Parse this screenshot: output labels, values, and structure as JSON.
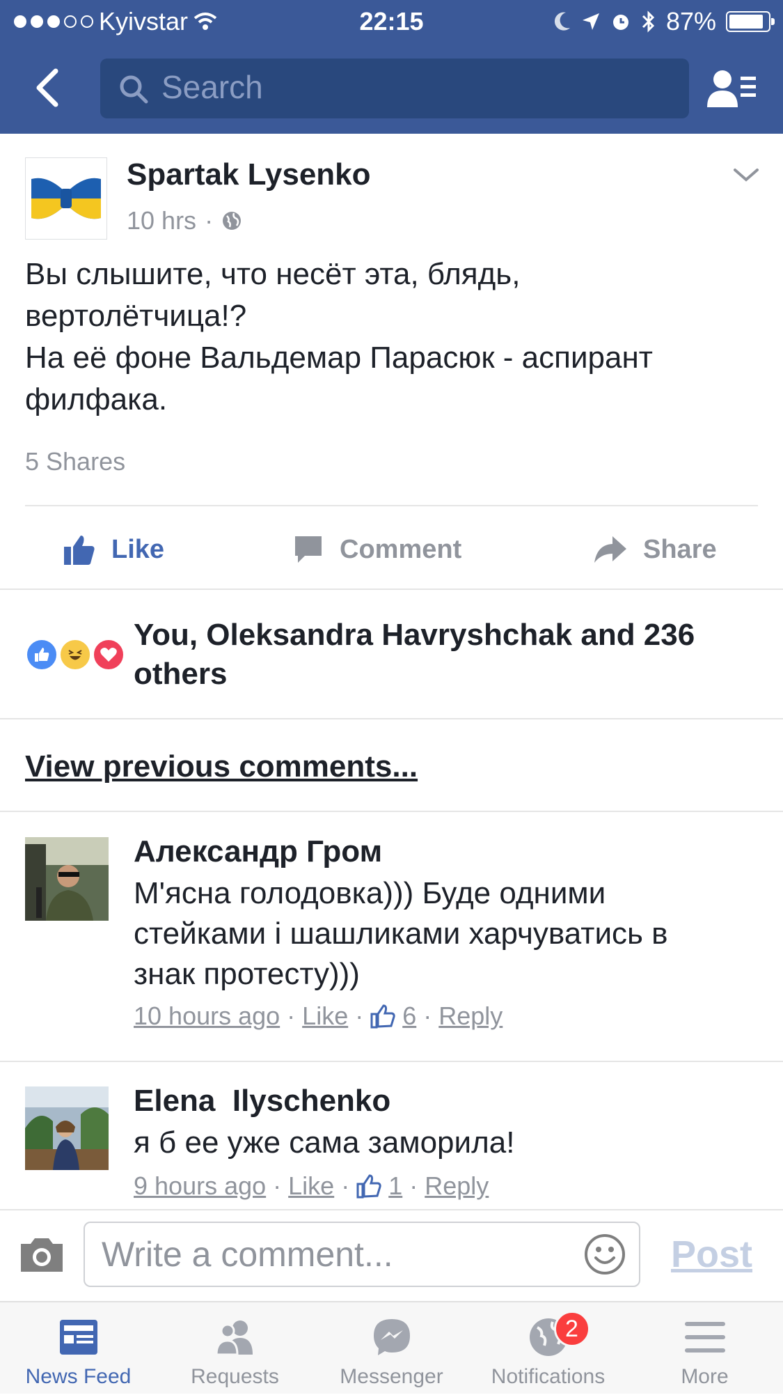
{
  "status_bar": {
    "carrier": "Kyivstar",
    "time": "22:15",
    "battery": "87%",
    "battery_level": 0.87
  },
  "nav": {
    "search_placeholder": "Search"
  },
  "post": {
    "author": "Spartak Lysenko",
    "time": "10 hrs",
    "separator": "·",
    "text_lines": [
      "Вы слышите, что несёт эта, блядь,",
      "вертолётчица!?",
      "На её фоне Вальдемар Парасюк - аспирант",
      "филфака."
    ],
    "shares": "5 Shares",
    "actions": {
      "like": "Like",
      "comment": "Comment",
      "share": "Share"
    },
    "likers": "You, Oleksandra Havryshchak and 236 others",
    "view_previous": "View previous comments..."
  },
  "comments": [
    {
      "name": "Александр Гром",
      "lines": [
        "М'ясна голодовка))) Буде одними",
        "стейками і шашликами харчуватись в",
        "знак протесту)))"
      ],
      "time": "10 hours ago",
      "like": "Like",
      "likes": "6",
      "reply": "Reply",
      "sep": "·"
    },
    {
      "name": "Elena  Ilyschenko",
      "lines": [
        "я б ее уже сама заморила!"
      ],
      "time": "9 hours ago",
      "like": "Like",
      "likes": "1",
      "reply": "Reply",
      "sep": "·"
    }
  ],
  "composer": {
    "placeholder": "Write a comment...",
    "post": "Post"
  },
  "tabs": [
    {
      "label": "News Feed",
      "icon": "news-feed-icon",
      "active": true
    },
    {
      "label": "Requests",
      "icon": "requests-icon"
    },
    {
      "label": "Messenger",
      "icon": "messenger-icon"
    },
    {
      "label": "Notifications",
      "icon": "notifications-icon",
      "badge": "2"
    },
    {
      "label": "More",
      "icon": "more-icon"
    }
  ],
  "colors": {
    "brand": "#3b5998",
    "link_blue": "#4267b2",
    "badge_red": "#fa3e3e"
  }
}
